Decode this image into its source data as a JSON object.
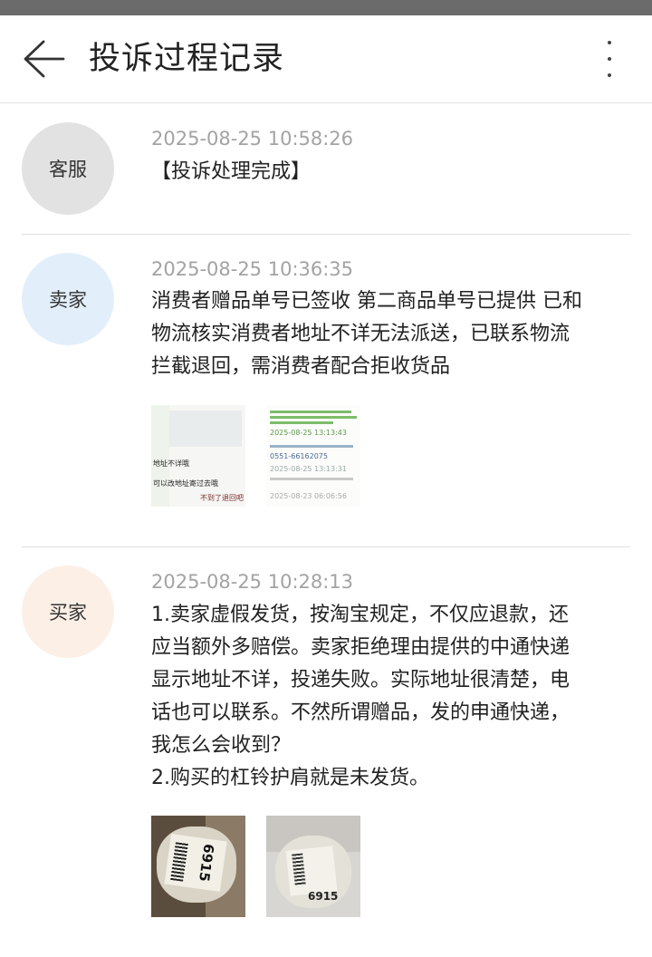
{
  "header": {
    "title": "投诉过程记录"
  },
  "entries": [
    {
      "role": "客服",
      "avatar_color": "#e2e2e2",
      "time": "2025-08-25 10:58:26",
      "lines": [
        "【投诉处理完成】"
      ]
    },
    {
      "role": "卖家",
      "avatar_color": "#e2effb",
      "time": "2025-08-25 10:36:35",
      "lines": [
        "消费者赠品单号已签收 第二商品单号已提供 已和",
        "物流核实消费者地址不详无法派送，已联系物流",
        "拦截退回，需消费者配合拒收货品"
      ],
      "attachments": [
        {
          "notes": [
            "地址不详哦",
            "可以改地址寄过去哦",
            "不到了退回吧"
          ]
        },
        {
          "notes": [
            "2025-08-25 13:13:43",
            "0551-66162075",
            "2025-08-25 13:13:31",
            "2025-08-23 06:06:56"
          ]
        }
      ]
    },
    {
      "role": "买家",
      "avatar_color": "#fcefe6",
      "time": "2025-08-25 10:28:13",
      "lines": [
        "1.卖家虚假发货，按淘宝规定，不仅应退款，还",
        "应当额外多赔偿。卖家拒绝理由提供的中通快递",
        "显示地址不详，投递失败。实际地址很清楚，电",
        "话也可以联系。不然所谓赠品，发的申通快递，",
        "我怎么会收到？",
        "2.购买的杠铃护肩就是未发货。"
      ],
      "attachments": [
        {
          "label": "6915"
        },
        {
          "label": "6915"
        }
      ]
    }
  ]
}
